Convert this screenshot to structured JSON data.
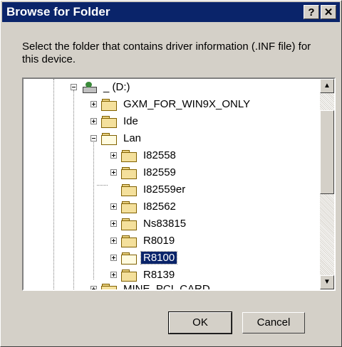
{
  "dialog": {
    "title": "Browse for Folder",
    "help_glyph": "?",
    "close_glyph": "✕",
    "description": "Select the folder that contains driver information (.INF file) for this device."
  },
  "tree": {
    "items": [
      {
        "label": "_ (D:)",
        "icon": "drive-icon",
        "expander": "minus"
      },
      {
        "label": "GXM_FOR_WIN9X_ONLY",
        "icon": "folder-icon",
        "expander": "plus"
      },
      {
        "label": "Ide",
        "icon": "folder-icon",
        "expander": "plus"
      },
      {
        "label": "Lan",
        "icon": "folder-open-icon",
        "expander": "minus"
      },
      {
        "label": "I82558",
        "icon": "folder-icon",
        "expander": "plus"
      },
      {
        "label": "I82559",
        "icon": "folder-icon",
        "expander": "plus"
      },
      {
        "label": "I82559er",
        "icon": "folder-icon",
        "expander": "none"
      },
      {
        "label": "I82562",
        "icon": "folder-icon",
        "expander": "plus"
      },
      {
        "label": "Ns83815",
        "icon": "folder-icon",
        "expander": "plus"
      },
      {
        "label": "R8019",
        "icon": "folder-icon",
        "expander": "plus"
      },
      {
        "label": "R8100",
        "icon": "folder-open-icon",
        "expander": "plus",
        "selected": true
      },
      {
        "label": "R8139",
        "icon": "folder-icon",
        "expander": "plus"
      },
      {
        "label": "MINE_PCI_CARD",
        "icon": "folder-icon",
        "expander": "plus"
      }
    ]
  },
  "buttons": {
    "ok": "OK",
    "cancel": "Cancel"
  },
  "colors": {
    "titlebar": "#0a246a",
    "face": "#d4d0c8",
    "selection": "#0a246a"
  }
}
